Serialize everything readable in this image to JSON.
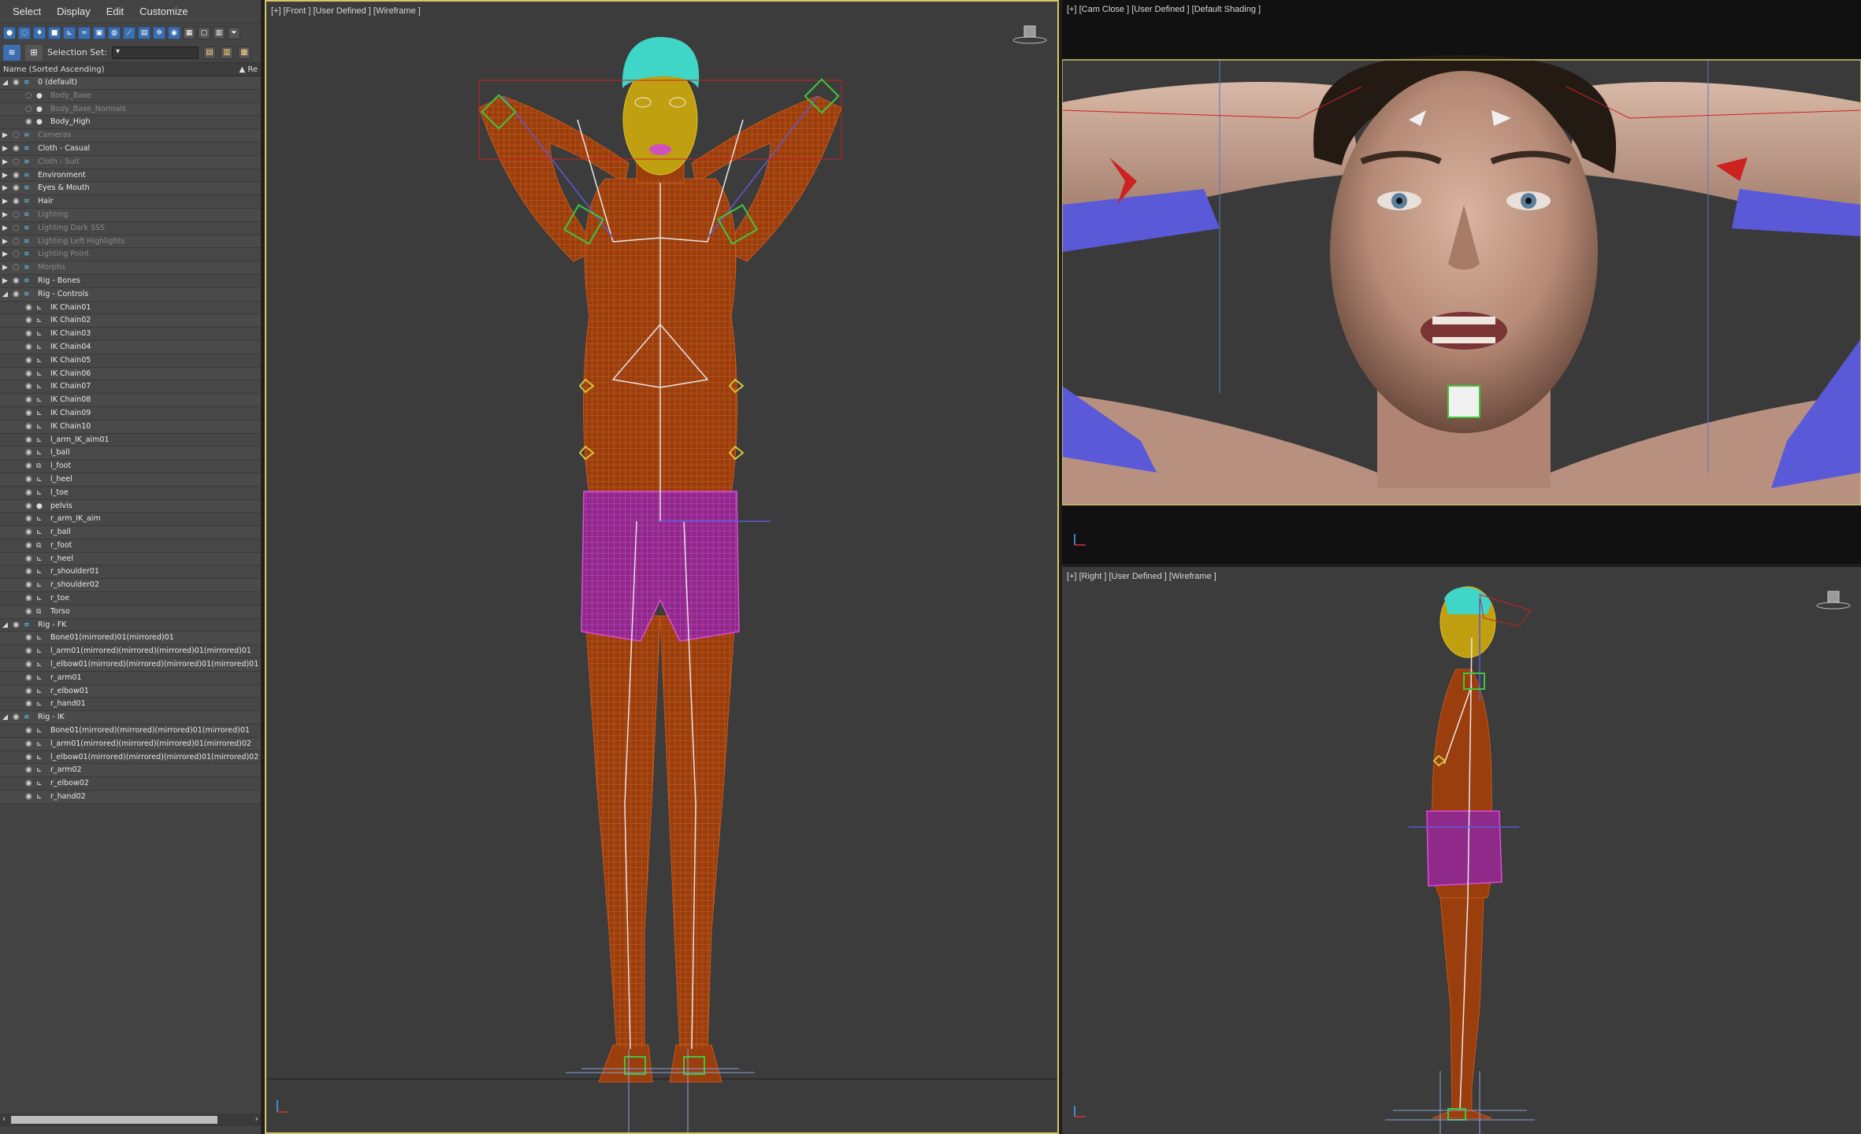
{
  "menubar": {
    "items": [
      "Select",
      "Display",
      "Edit",
      "Customize"
    ]
  },
  "toolbar": {
    "selection_set_label": "Selection Set:"
  },
  "column_header": {
    "name": "Name (Sorted Ascending)",
    "right": "▲ Re"
  },
  "tree": [
    {
      "label": "0 (default)",
      "level": 0,
      "expand": "down",
      "icon": "layer",
      "dim": false
    },
    {
      "label": "Body_Base",
      "level": 1,
      "expand": "",
      "icon": "sphere",
      "dim": true
    },
    {
      "label": "Body_Base_Normals",
      "level": 1,
      "expand": "",
      "icon": "sphere",
      "dim": true
    },
    {
      "label": "Body_High",
      "level": 1,
      "expand": "",
      "icon": "sphere",
      "dim": false
    },
    {
      "label": "Cameras",
      "level": 0,
      "expand": "right",
      "icon": "layer",
      "dim": true
    },
    {
      "label": "Cloth - Casual",
      "level": 0,
      "expand": "right",
      "icon": "layer",
      "dim": false
    },
    {
      "label": "Cloth - Suit",
      "level": 0,
      "expand": "right",
      "icon": "layer",
      "dim": true
    },
    {
      "label": "Environment",
      "level": 0,
      "expand": "right",
      "icon": "layer",
      "dim": false
    },
    {
      "label": "Eyes & Mouth",
      "level": 0,
      "expand": "right",
      "icon": "layer",
      "dim": false
    },
    {
      "label": "Hair",
      "level": 0,
      "expand": "right",
      "icon": "layer",
      "dim": false
    },
    {
      "label": "Lighting",
      "level": 0,
      "expand": "right",
      "icon": "layer",
      "dim": true
    },
    {
      "label": "Lighting Dark SSS",
      "level": 0,
      "expand": "right",
      "icon": "layer",
      "dim": true
    },
    {
      "label": "Lighting Left Highlights",
      "level": 0,
      "expand": "right",
      "icon": "layer",
      "dim": true
    },
    {
      "label": "Lighting Point",
      "level": 0,
      "expand": "right",
      "icon": "layer",
      "dim": true
    },
    {
      "label": "Morphs",
      "level": 0,
      "expand": "right",
      "icon": "layer",
      "dim": true
    },
    {
      "label": "Rig - Bones",
      "level": 0,
      "expand": "right",
      "icon": "layer",
      "dim": false
    },
    {
      "label": "Rig - Controls",
      "level": 0,
      "expand": "down",
      "icon": "layer",
      "dim": false
    },
    {
      "label": "IK Chain01",
      "level": 1,
      "expand": "",
      "icon": "bone",
      "dim": false
    },
    {
      "label": "IK Chain02",
      "level": 1,
      "expand": "",
      "icon": "bone",
      "dim": false
    },
    {
      "label": "IK Chain03",
      "level": 1,
      "expand": "",
      "icon": "bone",
      "dim": false
    },
    {
      "label": "IK Chain04",
      "level": 1,
      "expand": "",
      "icon": "bone",
      "dim": false
    },
    {
      "label": "IK Chain05",
      "level": 1,
      "expand": "",
      "icon": "bone",
      "dim": false
    },
    {
      "label": "IK Chain06",
      "level": 1,
      "expand": "",
      "icon": "bone",
      "dim": false
    },
    {
      "label": "IK Chain07",
      "level": 1,
      "expand": "",
      "icon": "bone",
      "dim": false
    },
    {
      "label": "IK Chain08",
      "level": 1,
      "expand": "",
      "icon": "bone",
      "dim": false
    },
    {
      "label": "IK Chain09",
      "level": 1,
      "expand": "",
      "icon": "bone",
      "dim": false
    },
    {
      "label": "IK Chain10",
      "level": 1,
      "expand": "",
      "icon": "bone",
      "dim": false
    },
    {
      "label": "l_arm_IK_aim01",
      "level": 1,
      "expand": "",
      "icon": "bone",
      "dim": false
    },
    {
      "label": "l_ball",
      "level": 1,
      "expand": "",
      "icon": "bone",
      "dim": false
    },
    {
      "label": "l_foot",
      "level": 1,
      "expand": "",
      "icon": "group",
      "dim": false
    },
    {
      "label": "l_heel",
      "level": 1,
      "expand": "",
      "icon": "bone",
      "dim": false
    },
    {
      "label": "l_toe",
      "level": 1,
      "expand": "",
      "icon": "bone",
      "dim": false
    },
    {
      "label": "pelvis",
      "level": 1,
      "expand": "",
      "icon": "sphere",
      "dim": false
    },
    {
      "label": "r_arm_IK_aim",
      "level": 1,
      "expand": "",
      "icon": "bone",
      "dim": false
    },
    {
      "label": "r_ball",
      "level": 1,
      "expand": "",
      "icon": "bone",
      "dim": false
    },
    {
      "label": "r_foot",
      "level": 1,
      "expand": "",
      "icon": "group",
      "dim": false
    },
    {
      "label": "r_heel",
      "level": 1,
      "expand": "",
      "icon": "bone",
      "dim": false
    },
    {
      "label": "r_shoulder01",
      "level": 1,
      "expand": "",
      "icon": "bone",
      "dim": false
    },
    {
      "label": "r_shoulder02",
      "level": 1,
      "expand": "",
      "icon": "bone",
      "dim": false
    },
    {
      "label": "r_toe",
      "level": 1,
      "expand": "",
      "icon": "bone",
      "dim": false
    },
    {
      "label": "Torso",
      "level": 1,
      "expand": "",
      "icon": "group",
      "dim": false
    },
    {
      "label": "Rig - FK",
      "level": 0,
      "expand": "down",
      "icon": "layer",
      "dim": false
    },
    {
      "label": "Bone01(mirrored)01(mirrored)01",
      "level": 1,
      "expand": "",
      "icon": "bone",
      "dim": false
    },
    {
      "label": "l_arm01(mirrored)(mirrored)(mirrored)01(mirrored)01",
      "level": 1,
      "expand": "",
      "icon": "bone",
      "dim": false
    },
    {
      "label": "l_elbow01(mirrored)(mirrored)(mirrored)01(mirrored)01",
      "level": 1,
      "expand": "",
      "icon": "bone",
      "dim": false
    },
    {
      "label": "r_arm01",
      "level": 1,
      "expand": "",
      "icon": "bone",
      "dim": false
    },
    {
      "label": "r_elbow01",
      "level": 1,
      "expand": "",
      "icon": "bone",
      "dim": false
    },
    {
      "label": "r_hand01",
      "level": 1,
      "expand": "",
      "icon": "bone",
      "dim": false
    },
    {
      "label": "Rig - IK",
      "level": 0,
      "expand": "down",
      "icon": "layer",
      "dim": false
    },
    {
      "label": "Bone01(mirrored)(mirrored)(mirrored)01(mirrored)01",
      "level": 1,
      "expand": "",
      "icon": "bone",
      "dim": false
    },
    {
      "label": "l_arm01(mirrored)(mirrored)(mirrored)01(mirrored)02",
      "level": 1,
      "expand": "",
      "icon": "bone",
      "dim": false
    },
    {
      "label": "l_elbow01(mirrored)(mirrored)(mirrored)01(mirrored)02",
      "level": 1,
      "expand": "",
      "icon": "bone",
      "dim": false
    },
    {
      "label": "r_arm02",
      "level": 1,
      "expand": "",
      "icon": "bone",
      "dim": false
    },
    {
      "label": "r_elbow02",
      "level": 1,
      "expand": "",
      "icon": "bone",
      "dim": false
    },
    {
      "label": "r_hand02",
      "level": 1,
      "expand": "",
      "icon": "bone",
      "dim": false
    }
  ],
  "viewports": {
    "front": {
      "label": "[+] [Front ] [User Defined ] [Wireframe ]"
    },
    "cam": {
      "label": "[+] [Cam Close ] [User Defined ] [Default Shading ]"
    },
    "right": {
      "label": "[+] [Right ] [User Defined ] [Wireframe ]"
    }
  },
  "colors": {
    "wire_body": "#b8561a",
    "wire_shorts": "#c83cc0",
    "wire_hair": "#3fd6c8",
    "control_green": "#3ec63e",
    "control_yellow": "#d8c23a",
    "bone_white": "#e6e6e6",
    "active_border": "#d4c76a",
    "rig_blue": "#5a5ad8",
    "rig_red": "#cc2222"
  }
}
